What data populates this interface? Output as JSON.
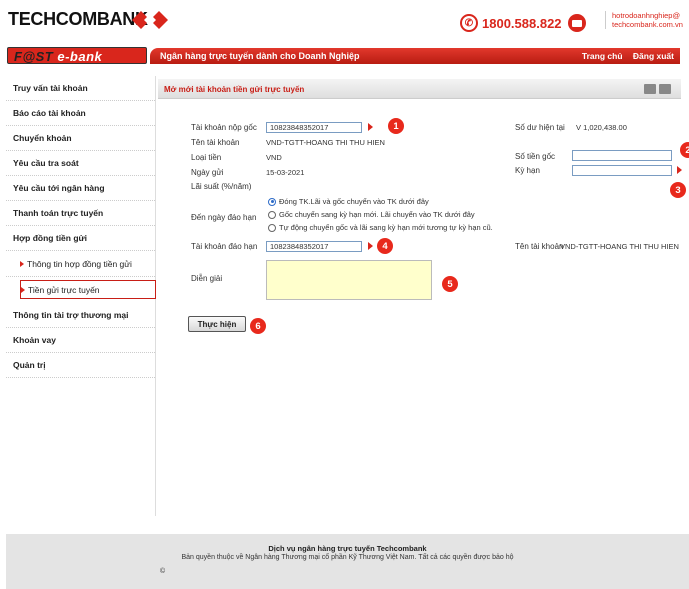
{
  "header": {
    "logo": "TECHCOMBANK",
    "hotline": "1800.588.822",
    "email_line1": "hotrodoanhnghiep@",
    "email_line2": "techcombank.com.vn"
  },
  "banner": {
    "fast_logo": "F@ST",
    "ebank_logo": "e-bank",
    "title": "Ngân hàng trực tuyến dành cho Doanh Nghiệp",
    "link_home": "Trang chủ",
    "link_logout": "Đăng xuất"
  },
  "sidebar": {
    "items": [
      {
        "label": "Truy vấn tài khoản"
      },
      {
        "label": "Báo cáo tài khoản"
      },
      {
        "label": "Chuyển khoản"
      },
      {
        "label": "Yêu cầu tra soát"
      },
      {
        "label": "Yêu cầu tới ngân hàng"
      },
      {
        "label": "Thanh toán trực tuyến"
      },
      {
        "label": "Hợp đồng tiền gửi"
      }
    ],
    "sub_items": [
      {
        "label": "Thông tin hợp đồng tiền gửi"
      },
      {
        "label": "Tiền gửi trực tuyến"
      }
    ],
    "items_after": [
      {
        "label": "Thông tin tài trợ thương mại"
      },
      {
        "label": "Khoản vay"
      },
      {
        "label": "Quản trị"
      }
    ]
  },
  "form": {
    "section_title": "Mở mới tài khoản tiền gửi trực tuyến",
    "source_account_label": "Tài khoản nộp gốc",
    "source_account_value": "10823848352017",
    "account_name_label": "Tên tài khoản",
    "account_name_value": "VND-TGTT-HOANG THI THU HIEN",
    "currency_label": "Loại tiền",
    "currency_value": "VND",
    "date_label": "Ngày gửi",
    "date_value": "15-03-2021",
    "rate_label": "Lãi suất (%/năm)",
    "balance_label": "Số dư hiện tại",
    "balance_value": "V 1,020,438.00",
    "principal_label": "Số tiền gốc",
    "term_label": "Kỳ hạn",
    "maturity_label": "Đến ngày đáo hạn",
    "maturity_options": [
      {
        "label": "Đóng TK.Lãi và gốc chuyển vào TK dưới đây",
        "selected": true
      },
      {
        "label": "Gốc chuyển sang kỳ hạn mới. Lãi chuyển vào TK dưới đây",
        "selected": false
      },
      {
        "label": "Tự động chuyển gốc và lãi sang kỳ hạn mới tương tự kỳ hạn cũ.",
        "selected": false
      }
    ],
    "maturity_account_label": "Tài khoản đáo hạn",
    "maturity_account_value": "10823848352017",
    "maturity_account_name_label": "Tên tài khoản",
    "maturity_account_name_value": "VND-TGTT-HOANG THI THU HIEN",
    "description_label": "Diễn giải",
    "submit_label": "Thực hiện"
  },
  "markers": [
    "1",
    "2",
    "3",
    "4",
    "5",
    "6"
  ],
  "footer": {
    "line1": "Dịch vụ ngân hàng trực tuyến Techcombank",
    "line2": "Bản quyền thuộc về Ngân hàng Thương mại cổ phần Kỹ Thương Việt Nam. Tất cả các quyền được bảo hộ",
    "copyright": "©"
  },
  "colors": {
    "brand_red": "#d9261c",
    "input_bg": "#ffffcc"
  }
}
